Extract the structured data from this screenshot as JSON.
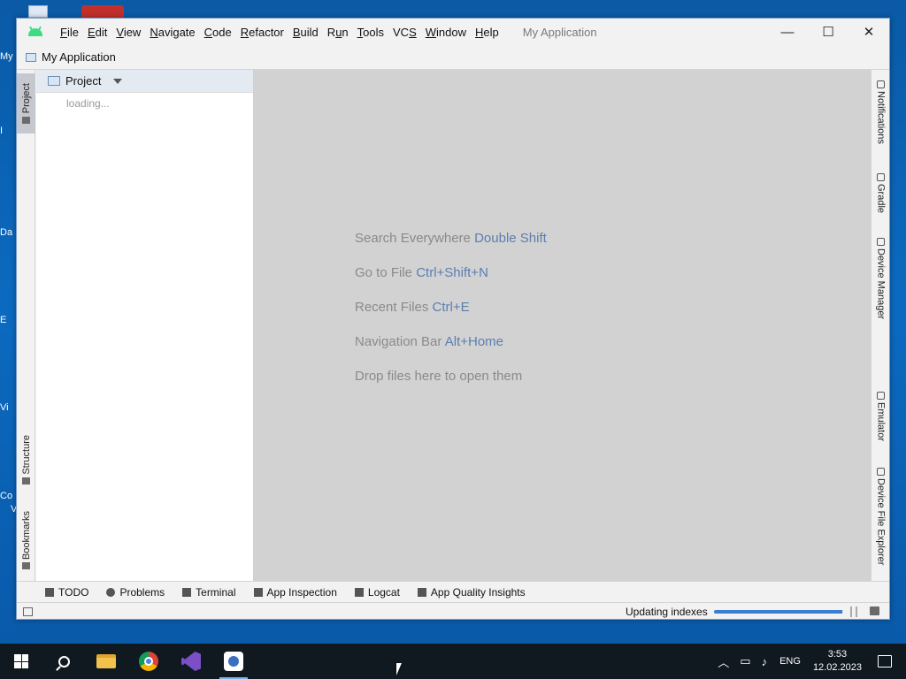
{
  "desktop": {
    "fragments": [
      "My",
      "I",
      "Da",
      "E",
      "Vi",
      "Co",
      "V"
    ]
  },
  "window": {
    "title": "My Application",
    "menu": [
      {
        "label": "File",
        "mnemonic": "F",
        "rest": "ile"
      },
      {
        "label": "Edit",
        "mnemonic": "E",
        "rest": "dit"
      },
      {
        "label": "View",
        "mnemonic": "V",
        "rest": "iew"
      },
      {
        "label": "Navigate",
        "mnemonic": "N",
        "rest": "avigate"
      },
      {
        "label": "Code",
        "mnemonic": "C",
        "rest": "ode"
      },
      {
        "label": "Refactor",
        "mnemonic": "R",
        "rest": "efactor"
      },
      {
        "label": "Build",
        "mnemonic": "B",
        "rest": "uild"
      },
      {
        "label": "Run",
        "mnemonic": "u",
        "pre": "R",
        "rest": "n"
      },
      {
        "label": "Tools",
        "mnemonic": "T",
        "rest": "ools"
      },
      {
        "label": "VCS",
        "mnemonic": "S",
        "pre": "VC",
        "rest": ""
      },
      {
        "label": "Window",
        "mnemonic": "W",
        "rest": "indow"
      },
      {
        "label": "Help",
        "mnemonic": "H",
        "rest": "elp"
      }
    ],
    "controls": {
      "minimize": "—",
      "maximize": "☐",
      "close": "✕"
    }
  },
  "navbar": {
    "breadcrumb": "My Application"
  },
  "left_tabs": {
    "project": "Project",
    "structure": "Structure",
    "bookmarks": "Bookmarks"
  },
  "project_panel": {
    "title": "Project",
    "loading": "loading..."
  },
  "editor": {
    "hints": [
      {
        "text": "Search Everywhere",
        "key": "Double Shift"
      },
      {
        "text": "Go to File",
        "key": "Ctrl+Shift+N"
      },
      {
        "text": "Recent Files",
        "key": "Ctrl+E"
      },
      {
        "text": "Navigation Bar",
        "key": "Alt+Home"
      },
      {
        "text": "Drop files here to open them",
        "key": ""
      }
    ]
  },
  "right_tabs": {
    "notifications": "Notifications",
    "gradle": "Gradle",
    "device_manager": "Device Manager",
    "emulator": "Emulator",
    "device_file_explorer": "Device File Explorer"
  },
  "bottom_tools": [
    "TODO",
    "Problems",
    "Terminal",
    "App Inspection",
    "Logcat",
    "App Quality Insights"
  ],
  "status": {
    "text": "Updating indexes",
    "progress": 0.99
  },
  "taskbar": {
    "lang": "ENG",
    "time": "3:53",
    "date": "12.02.2023"
  }
}
